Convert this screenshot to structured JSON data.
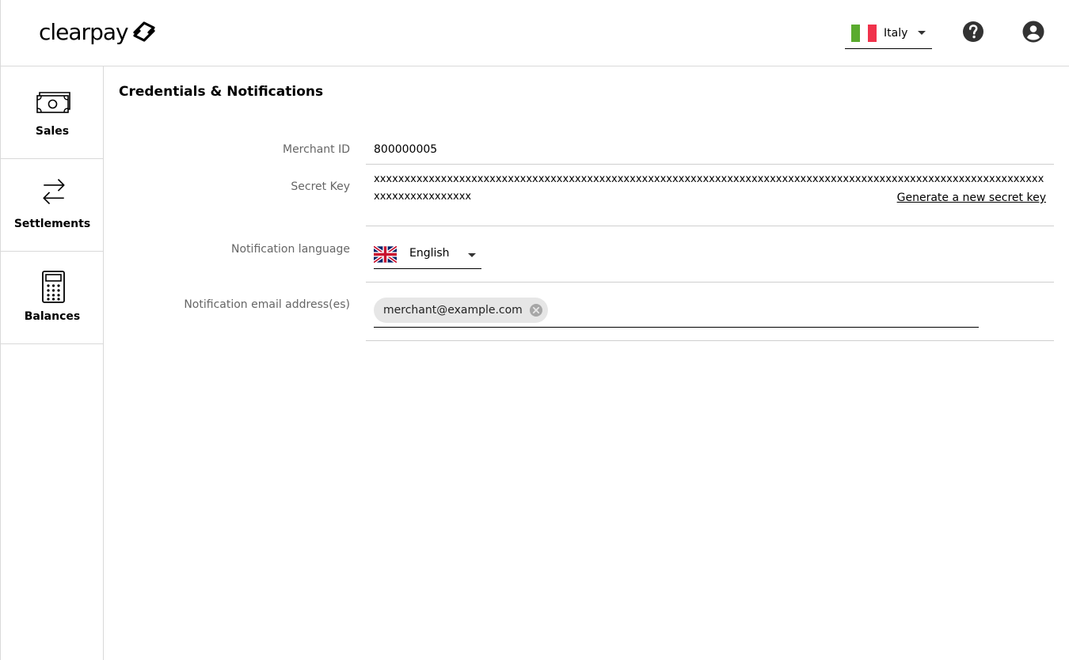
{
  "header": {
    "logo_text": "clearpay",
    "country": {
      "label": "Italy",
      "flag_colors": [
        "#009246",
        "#ffffff",
        "#ce2b37"
      ]
    },
    "help_icon": "help-circle-icon",
    "account_icon": "account-circle-icon"
  },
  "sidebar": {
    "items": [
      {
        "label": "Sales",
        "icon": "cash-icon"
      },
      {
        "label": "Settlements",
        "icon": "transfer-arrows-icon"
      },
      {
        "label": "Balances",
        "icon": "calculator-icon"
      }
    ]
  },
  "main": {
    "title": "Credentials & Notifications",
    "merchant_id": {
      "label": "Merchant ID",
      "value": "800000005"
    },
    "secret_key": {
      "label": "Secret Key",
      "value": "xxxxxxxxxxxxxxxxxxxxxxxxxxxxxxxxxxxxxxxxxxxxxxxxxxxxxxxxxxxxxxxxxxxxxxxxxxxxxxxxxxxxxxxxxxxxxxxxxxxxxxxxxxxxxxxxxxxxxxxxxxxxxx",
      "regenerate_label": "Generate a new secret key"
    },
    "notification_language": {
      "label": "Notification language",
      "value": "English"
    },
    "notification_emails": {
      "label": "Notification email address(es)",
      "chips": [
        "merchant@example.com"
      ]
    }
  }
}
